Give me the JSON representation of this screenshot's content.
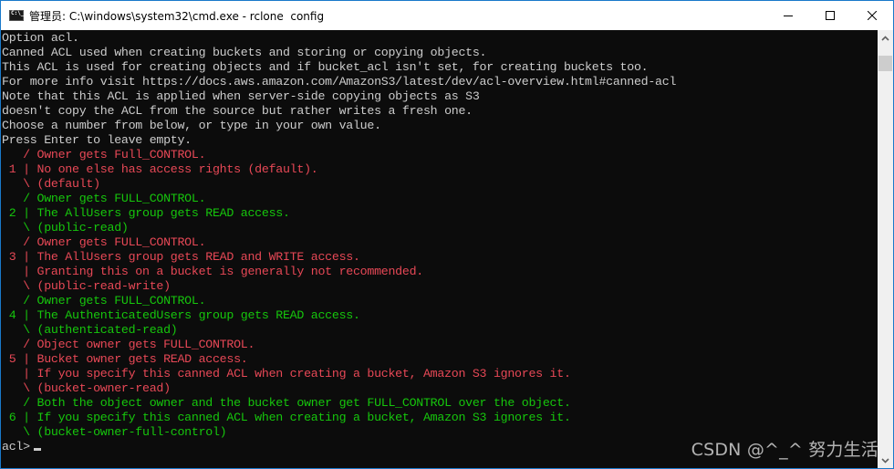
{
  "window": {
    "title": "管理员: C:\\windows\\system32\\cmd.exe - rclone  config",
    "controls": {
      "minimize": "minimize",
      "maximize": "maximize",
      "close": "close"
    }
  },
  "colors": {
    "background": "#0c0c0c",
    "default_text": "#cccccc",
    "red": "#e74856",
    "green": "#16c60c"
  },
  "console": {
    "lines": [
      {
        "text": "Option acl.",
        "color": "white"
      },
      {
        "text": "Canned ACL used when creating buckets and storing or copying objects.",
        "color": "white"
      },
      {
        "text": "This ACL is used for creating objects and if bucket_acl isn't set, for creating buckets too.",
        "color": "white"
      },
      {
        "text": "For more info visit https://docs.aws.amazon.com/AmazonS3/latest/dev/acl-overview.html#canned-acl",
        "color": "white"
      },
      {
        "text": "Note that this ACL is applied when server-side copying objects as S3",
        "color": "white"
      },
      {
        "text": "doesn't copy the ACL from the source but rather writes a fresh one.",
        "color": "white"
      },
      {
        "text": "Choose a number from below, or type in your own value.",
        "color": "white"
      },
      {
        "text": "Press Enter to leave empty.",
        "color": "white"
      },
      {
        "text": "   / Owner gets Full_CONTROL.",
        "color": "red"
      },
      {
        "text": " 1 | No one else has access rights (default).",
        "color": "red"
      },
      {
        "text": "   \\ (default)",
        "color": "red"
      },
      {
        "text": "   / Owner gets FULL_CONTROL.",
        "color": "green"
      },
      {
        "text": " 2 | The AllUsers group gets READ access.",
        "color": "green"
      },
      {
        "text": "   \\ (public-read)",
        "color": "green"
      },
      {
        "text": "   / Owner gets FULL_CONTROL.",
        "color": "red"
      },
      {
        "text": " 3 | The AllUsers group gets READ and WRITE access.",
        "color": "red"
      },
      {
        "text": "   | Granting this on a bucket is generally not recommended.",
        "color": "red"
      },
      {
        "text": "   \\ (public-read-write)",
        "color": "red"
      },
      {
        "text": "   / Owner gets FULL_CONTROL.",
        "color": "green"
      },
      {
        "text": " 4 | The AuthenticatedUsers group gets READ access.",
        "color": "green"
      },
      {
        "text": "   \\ (authenticated-read)",
        "color": "green"
      },
      {
        "text": "   / Object owner gets FULL_CONTROL.",
        "color": "red"
      },
      {
        "text": " 5 | Bucket owner gets READ access.",
        "color": "red"
      },
      {
        "text": "   | If you specify this canned ACL when creating a bucket, Amazon S3 ignores it.",
        "color": "red"
      },
      {
        "text": "   \\ (bucket-owner-read)",
        "color": "red"
      },
      {
        "text": "   / Both the object owner and the bucket owner get FULL_CONTROL over the object.",
        "color": "green"
      },
      {
        "text": " 6 | If you specify this canned ACL when creating a bucket, Amazon S3 ignores it.",
        "color": "green"
      },
      {
        "text": "   \\ (bucket-owner-full-control)",
        "color": "green"
      }
    ],
    "prompt": "acl>",
    "input_value": ""
  },
  "watermark": "CSDN @^_^ 努力生活"
}
